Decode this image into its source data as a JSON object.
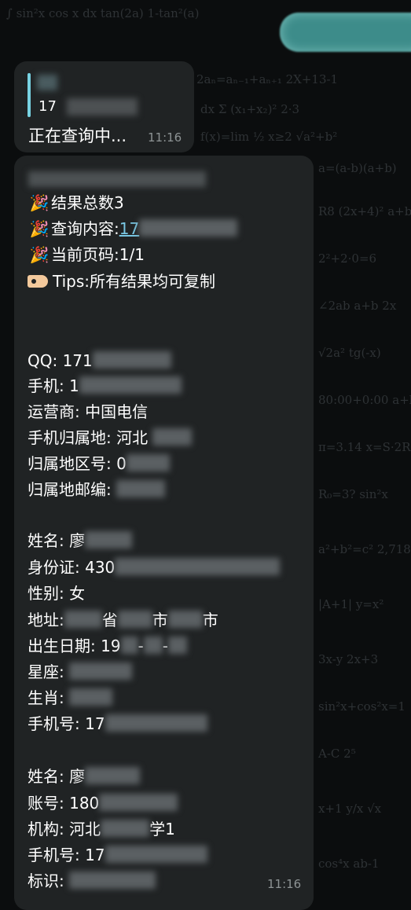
{
  "chat": {
    "reply": {
      "quoted_number": "17",
      "status": "正在查询中...",
      "time": "11:16"
    },
    "result": {
      "summary": {
        "total": "结果总数3",
        "query_label": "查询内容:",
        "query_value": "17",
        "page": "当前页码:1/1",
        "tips": "Tips:所有结果均可复制"
      },
      "phone_record": {
        "qq": "QQ: 171",
        "phone": "手机: 1",
        "carrier": "运营商: 中国电信",
        "location": "手机归属地: 河北",
        "area_code": "归属地区号: 0",
        "postal_code": "归属地邮编:"
      },
      "person_record_1": {
        "name": "姓名: 廖",
        "id_card": "身份证: 430",
        "gender": "性别: 女",
        "address_label": "地址:",
        "address_province": "省",
        "address_city": "市",
        "address_city2": "市",
        "birth_date": "出生日期: 19",
        "birth_sep1": "-",
        "birth_sep2": "-",
        "zodiac": "星座:",
        "chinese_zodiac": "生肖:",
        "phone": "手机号: 17"
      },
      "person_record_2": {
        "name": "姓名: 廖",
        "account": "账号: 180",
        "institution": "机构: 河北",
        "institution_suffix": "学1",
        "phone": "手机号: 17",
        "identifier": "标识:"
      },
      "time": "11:16"
    }
  },
  "icons": {
    "party": "party-popper-icon",
    "tag": "tag-icon"
  },
  "colors": {
    "bubble": "#202324",
    "link": "#79c7e3",
    "outgoing": "#3d8c8a",
    "reply_bar": "#78d3e3"
  }
}
